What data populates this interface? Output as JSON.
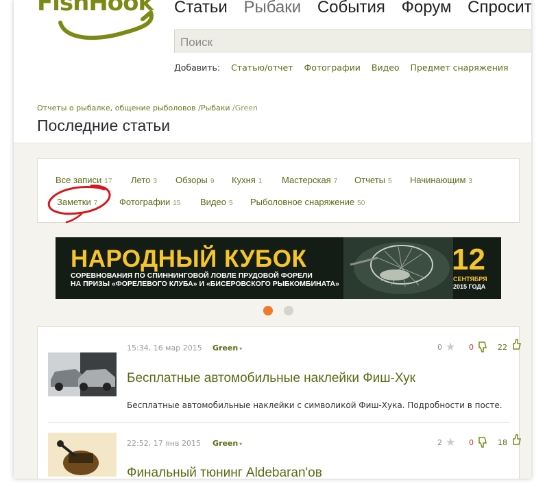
{
  "brand": {
    "name": "FishHook",
    "green": "#7b8a14",
    "link": "#5a6b13"
  },
  "nav": {
    "items": [
      "Статьи",
      "Рыбаки",
      "События",
      "Форум",
      "Спросит"
    ]
  },
  "search": {
    "placeholder": "Поиск"
  },
  "add": {
    "label": "Добавить:",
    "links": [
      "Статью/отчет",
      "Фотографии",
      "Видео",
      "Предмет снаряжения"
    ]
  },
  "breadcrumb": {
    "items": [
      "Отчеты о рыбалке, общение рыболовов",
      "/Рыбаки",
      "/Green"
    ]
  },
  "page": {
    "title": "Последние статьи"
  },
  "filters": [
    {
      "label": "Все записи",
      "count": "17"
    },
    {
      "label": "Лето",
      "count": "3"
    },
    {
      "label": "Обзоры",
      "count": "9"
    },
    {
      "label": "Кухня",
      "count": "1"
    },
    {
      "label": "Мастерская",
      "count": "7"
    },
    {
      "label": "Отчеты",
      "count": "5"
    },
    {
      "label": "Начинающим",
      "count": "3"
    },
    {
      "label": "Заметки",
      "count": "7"
    },
    {
      "label": "Фотографии",
      "count": "15"
    },
    {
      "label": "Видео",
      "count": "5"
    },
    {
      "label": "Рыболовное снаряжение",
      "count": "50"
    }
  ],
  "banner": {
    "title": "НАРОДНЫЙ КУБОК",
    "subtitle1": "СОРЕВНОВАНИЯ ПО СПИННИНГОВОЙ ЛОВЛЕ ПРУДОВОЙ ФОРЕЛИ",
    "subtitle2": "НА ПРИЗЫ «ФОРЕЛЕВОГО КЛУБА» И «БИСЕРОВСКОГО РЫБКОМБИНАТА»",
    "day": "12",
    "month": "СЕНТЯБРЯ",
    "year": "2015 ГОДА",
    "active_slide": 1,
    "slides": 2
  },
  "posts": [
    {
      "time": "15:34, 16 мар 2015",
      "author": "Green",
      "favorites": "0",
      "dislikes": "0",
      "likes": "22",
      "title": "Бесплатные автомобильные наклейки Фиш-Хук",
      "excerpt": "Бесплатные автомобильные наклейки с символикой Фиш-Хука. Подробности в посте."
    },
    {
      "time": "22:52, 17 янв 2015",
      "author": "Green",
      "favorites": "2",
      "dislikes": "0",
      "likes": "18",
      "title": "Финальный тюнинг Aldebaran'ов",
      "excerpt": ""
    }
  ]
}
